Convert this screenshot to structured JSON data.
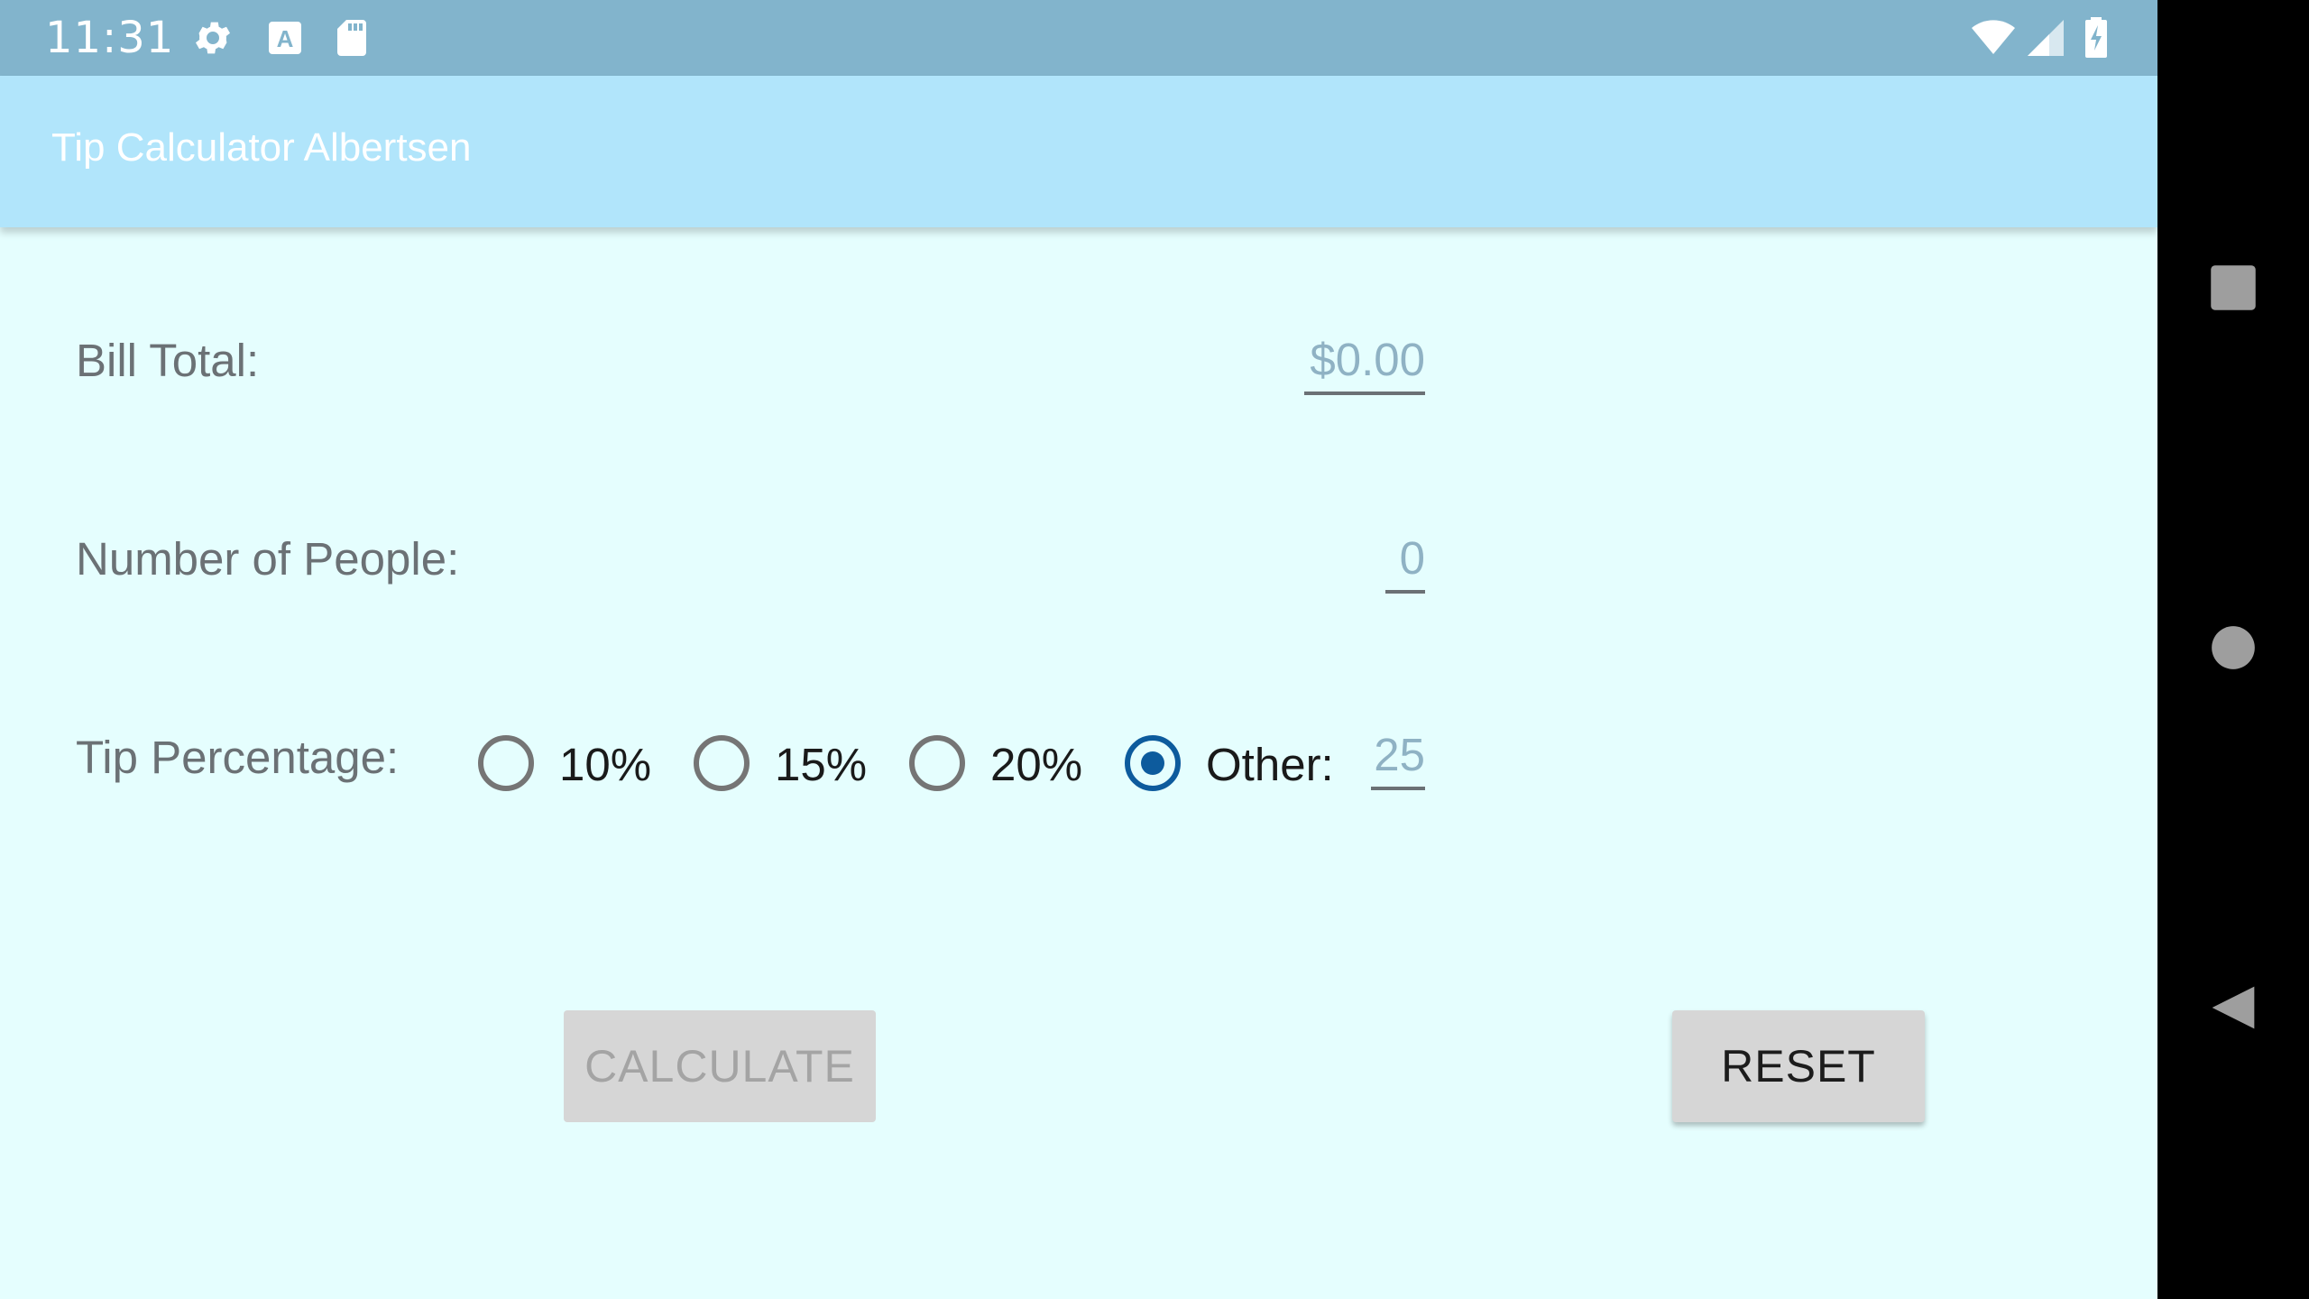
{
  "status_bar": {
    "time": "11:31",
    "left_icons": [
      "gear-icon",
      "a-font-icon",
      "sd-card-icon"
    ],
    "right_icons": [
      "wifi-icon",
      "cell-signal-icon",
      "battery-charging-icon"
    ]
  },
  "app_bar": {
    "title": "Tip Calculator Albertsen"
  },
  "form": {
    "bill_total": {
      "label": "Bill Total:",
      "value": "$0.00"
    },
    "num_people": {
      "label": "Number of People:",
      "value": "0"
    },
    "tip": {
      "label": "Tip Percentage:",
      "options": [
        {
          "label": "10%",
          "checked": false
        },
        {
          "label": "15%",
          "checked": false
        },
        {
          "label": "20%",
          "checked": false
        },
        {
          "label": "Other:",
          "checked": true
        }
      ],
      "other_value": "25"
    }
  },
  "buttons": {
    "calculate": "CALCULATE",
    "reset": "RESET"
  },
  "nav_bar": {
    "icons": [
      "recents-square-icon",
      "home-circle-icon",
      "back-triangle-icon"
    ]
  },
  "colors": {
    "status_bar": "#82b4cc",
    "app_bar": "#b1e5fb",
    "background": "#e5fefe",
    "accent": "#0d5b9d"
  }
}
